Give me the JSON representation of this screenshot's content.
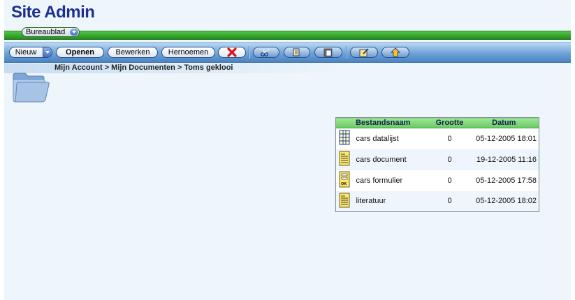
{
  "header": {
    "site_title": "Site Admin",
    "desktop_label": "Bureaublad"
  },
  "toolbar": {
    "new_label": "Nieuw",
    "open_label": "Openen",
    "edit_label": "Bewerken",
    "rename_label": "Hernoemen",
    "icons": [
      "delete-icon",
      "cut-icon",
      "copy-icon",
      "paste-icon",
      "edit-page-icon",
      "upload-icon"
    ]
  },
  "breadcrumb": "Mijn Account > Mijn Documenten > Toms geklooi",
  "files": {
    "columns": [
      "Bestandsnaam",
      "Grootte",
      "Datum"
    ],
    "rows": [
      {
        "icon": "datalist-icon",
        "name": "cars datalijst",
        "size": "0",
        "date": "05-12-2005 18:01"
      },
      {
        "icon": "document-icon",
        "name": "cars document",
        "size": "0",
        "date": "19-12-2005 11:16"
      },
      {
        "icon": "form-icon",
        "name": "cars formulier",
        "size": "0",
        "date": "05-12-2005 17:58"
      },
      {
        "icon": "document-icon",
        "name": "literatuur",
        "size": "0",
        "date": "05-12-2005 18:02"
      }
    ]
  },
  "colors": {
    "title": "#1c2f8f",
    "green_bar": "#3aab30",
    "toolbar": "#6ea3d8",
    "table_header": "#7fd575",
    "background": "#eef6fc"
  }
}
